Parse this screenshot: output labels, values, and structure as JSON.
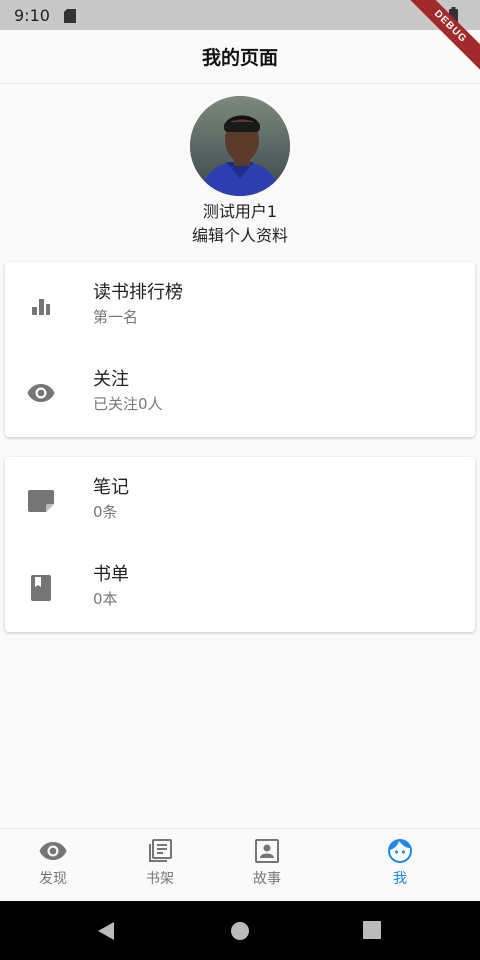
{
  "status_bar": {
    "time": "9:10",
    "icons": [
      "sd-card-icon",
      "wifi-icon",
      "battery-icon"
    ]
  },
  "debug_banner": "DEBUG",
  "app_bar": {
    "title": "我的页面"
  },
  "profile": {
    "username": "测试用户1",
    "edit_label": "编辑个人资料"
  },
  "menu_groups": [
    {
      "items": [
        {
          "icon": "bar-chart-icon",
          "title": "读书排行榜",
          "subtitle": "第一名"
        },
        {
          "icon": "eye-icon",
          "title": "关注",
          "subtitle": "已关注0人"
        }
      ]
    },
    {
      "items": [
        {
          "icon": "note-icon",
          "title": "笔记",
          "subtitle": "0条"
        },
        {
          "icon": "book-icon",
          "title": "书单",
          "subtitle": "0本"
        }
      ]
    }
  ],
  "bottom_nav": {
    "items": [
      {
        "icon": "eye-icon",
        "label": "发现"
      },
      {
        "icon": "library-books-icon",
        "label": "书架"
      },
      {
        "icon": "portrait-icon",
        "label": "故事"
      },
      {
        "icon": "face-icon",
        "label": "我"
      }
    ],
    "active_label": "我"
  },
  "colors": {
    "accent": "#1e88e5",
    "icon_grey": "#757575",
    "status_bar": "#c8c8c8"
  }
}
